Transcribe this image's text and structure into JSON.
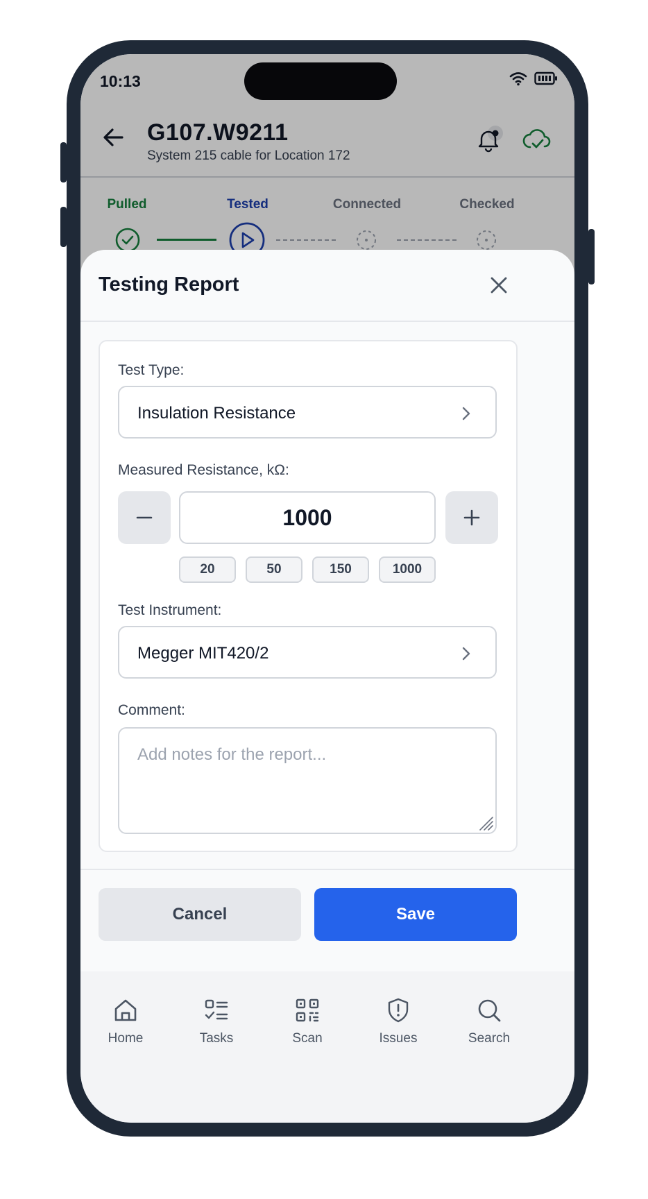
{
  "status_bar": {
    "time": "10:13"
  },
  "header": {
    "title": "G107.W9211",
    "subtitle": "System 215 cable for Location 172"
  },
  "steps": [
    {
      "label": "Pulled",
      "state": "done"
    },
    {
      "label": "Tested",
      "state": "current"
    },
    {
      "label": "Connected",
      "state": "pending"
    },
    {
      "label": "Checked",
      "state": "pending"
    }
  ],
  "sheet": {
    "title": "Testing Report",
    "test_type": {
      "label": "Test Type:",
      "value": "Insulation Resistance"
    },
    "resistance": {
      "label": "Measured Resistance, kΩ:",
      "value": "1000",
      "presets": [
        "20",
        "50",
        "150",
        "1000"
      ]
    },
    "instrument": {
      "label": "Test Instrument:",
      "value": "Megger MIT420/2"
    },
    "comment": {
      "label": "Comment:",
      "placeholder": "Add notes for the report..."
    },
    "cancel_label": "Cancel",
    "save_label": "Save"
  },
  "tabs": [
    {
      "label": "Home",
      "icon": "home-icon"
    },
    {
      "label": "Tasks",
      "icon": "tasks-icon"
    },
    {
      "label": "Scan",
      "icon": "qr-icon"
    },
    {
      "label": "Issues",
      "icon": "shield-alert-icon"
    },
    {
      "label": "Search",
      "icon": "search-icon"
    }
  ],
  "colors": {
    "accent": "#2563eb",
    "done": "#15803d",
    "current": "#1e40af",
    "pending": "#6b7280"
  }
}
